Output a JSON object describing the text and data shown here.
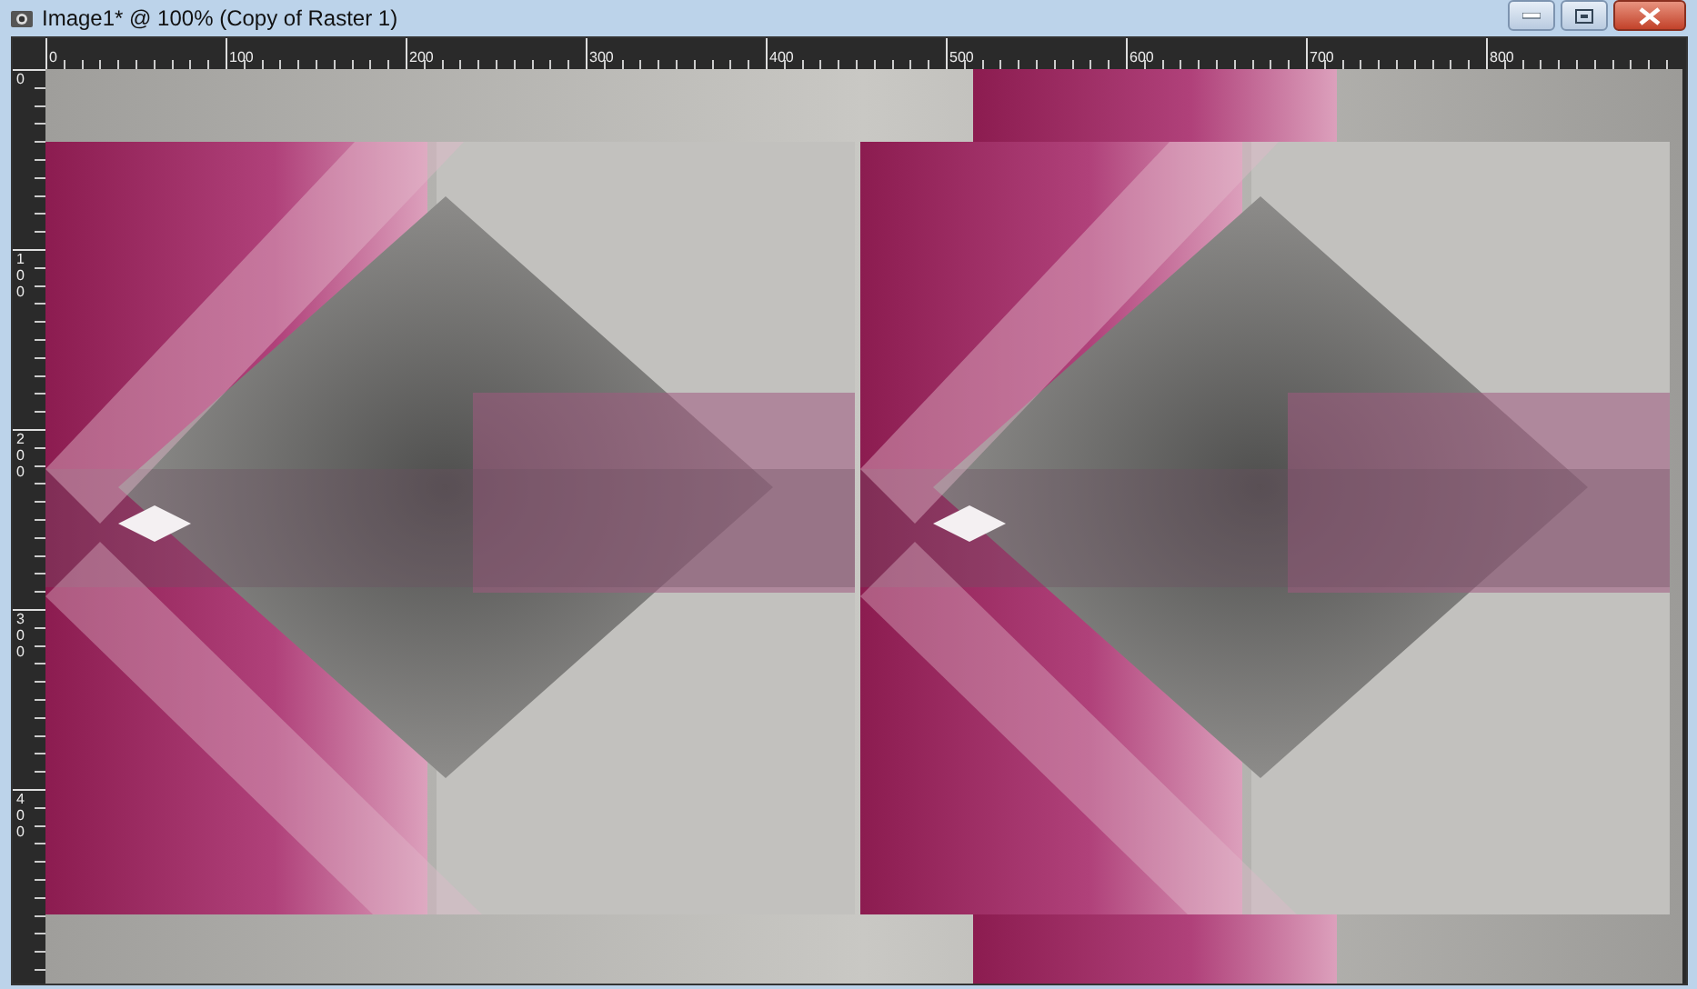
{
  "window": {
    "title": "Image1* @ 100% (Copy of Raster 1)"
  },
  "ruler": {
    "horizontal_labels": [
      "0",
      "100",
      "200",
      "300",
      "400",
      "500",
      "600",
      "700",
      "800"
    ],
    "vertical_labels": [
      "0",
      "100",
      "200",
      "300",
      "400"
    ]
  }
}
